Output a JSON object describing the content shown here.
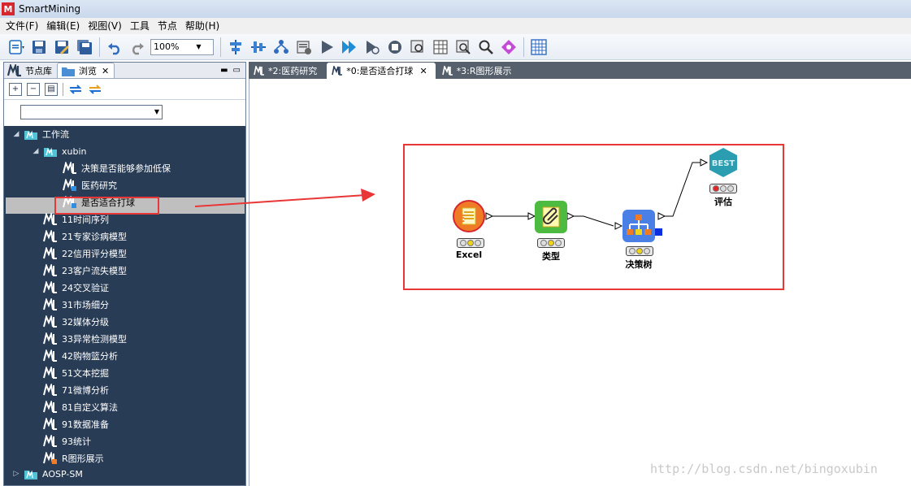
{
  "window": {
    "title": "SmartMining",
    "logo_letter": "M"
  },
  "menu": [
    "文件(F)",
    "编辑(E)",
    "视图(V)",
    "工具",
    "节点",
    "帮助(H)"
  ],
  "toolbar": {
    "zoom_value": "100%"
  },
  "left_panel": {
    "tabs": [
      {
        "label": "节点库"
      },
      {
        "label": "浏览"
      }
    ],
    "tree": [
      {
        "label": "工作流",
        "level": 0
      },
      {
        "label": "xubin",
        "level": 1
      },
      {
        "label": "决策是否能够参加低保",
        "level": 2
      },
      {
        "label": "医药研究",
        "level": 2
      },
      {
        "label": "是否适合打球",
        "level": 2,
        "selected": true
      },
      {
        "label": "11时间序列",
        "level": 1
      },
      {
        "label": "21专家诊病模型",
        "level": 1
      },
      {
        "label": "22信用评分模型",
        "level": 1
      },
      {
        "label": "23客户流失模型",
        "level": 1
      },
      {
        "label": "24交叉验证",
        "level": 1
      },
      {
        "label": "31市场细分",
        "level": 1
      },
      {
        "label": "32媒体分级",
        "level": 1
      },
      {
        "label": "33异常检测模型",
        "level": 1
      },
      {
        "label": "42购物篮分析",
        "level": 1
      },
      {
        "label": "51文本挖掘",
        "level": 1
      },
      {
        "label": "71微博分析",
        "level": 1
      },
      {
        "label": "81自定义算法",
        "level": 1
      },
      {
        "label": "91数据准备",
        "level": 1
      },
      {
        "label": "93统计",
        "level": 1
      },
      {
        "label": "R图形展示",
        "level": 1
      },
      {
        "label": "AOSP-SM",
        "level": 0
      }
    ]
  },
  "editor_tabs": [
    {
      "label": "*2:医药研究",
      "active": false
    },
    {
      "label": "*0:是否适合打球",
      "active": true
    },
    {
      "label": "*3:R图形展示",
      "active": false
    }
  ],
  "flow": {
    "nodes": [
      {
        "id": "excel",
        "label": "Excel",
        "icon": "excel-icon"
      },
      {
        "id": "type",
        "label": "类型",
        "icon": "type-icon"
      },
      {
        "id": "tree",
        "label": "决策树",
        "icon": "decision-tree-icon"
      },
      {
        "id": "eval",
        "label": "评估",
        "icon": "best-icon",
        "icon_text": "BEST"
      }
    ]
  },
  "watermark": "http://blog.csdn.net/bingoxubin",
  "colors": {
    "panel_bg": "#283c55",
    "highlight_red": "#e93636",
    "accent_blue": "#1a53c4"
  }
}
